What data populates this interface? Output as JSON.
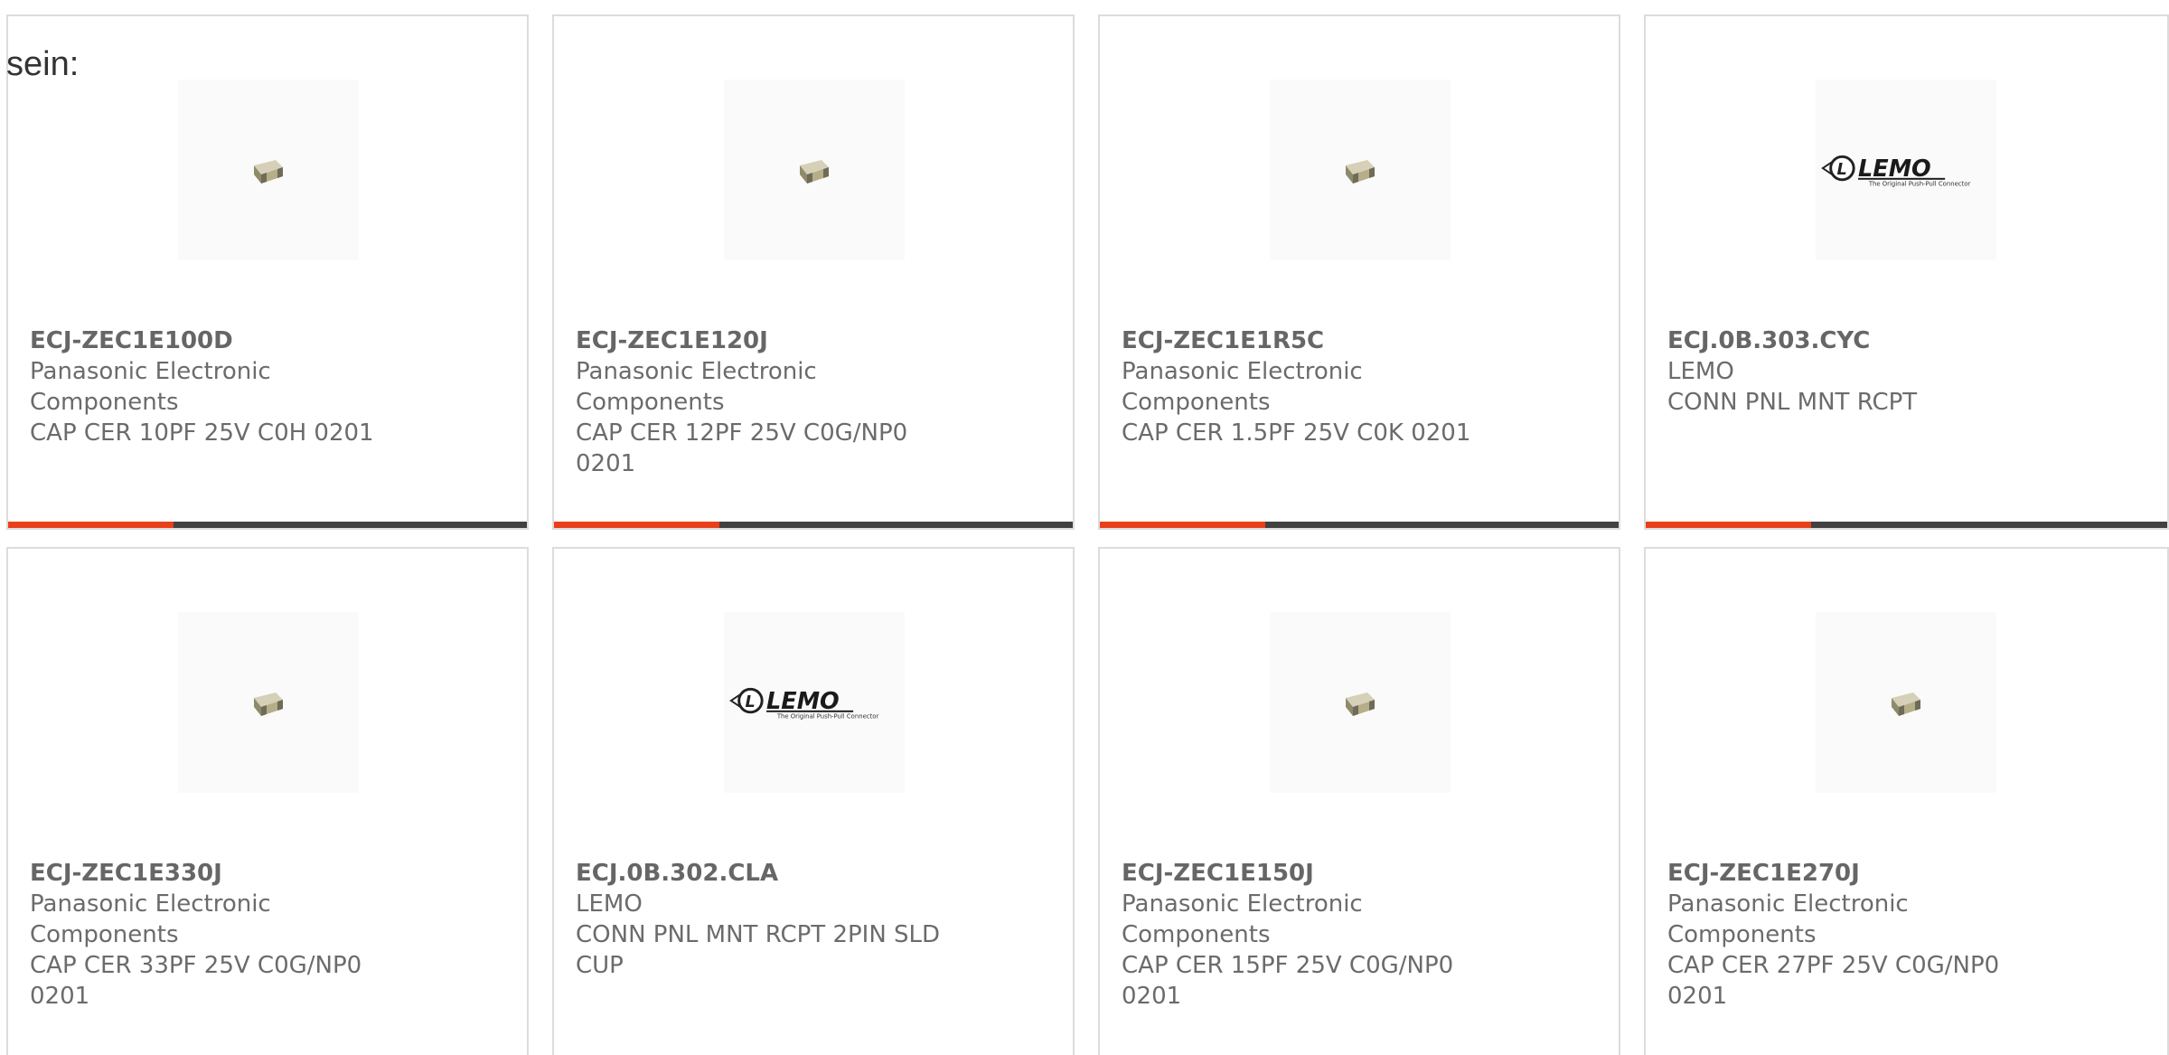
{
  "intro": "sein:",
  "cards": [
    {
      "part_number": "ECJ-ZEC1E100D",
      "manufacturer": "Panasonic Electronic Components",
      "description": "CAP CER 10PF 25V C0H 0201",
      "image": "capacitor-chip-icon"
    },
    {
      "part_number": "ECJ-ZEC1E120J",
      "manufacturer": "Panasonic Electronic Components",
      "description": "CAP CER 12PF 25V C0G/NP0 0201",
      "image": "capacitor-chip-icon"
    },
    {
      "part_number": "ECJ-ZEC1E1R5C",
      "manufacturer": "Panasonic Electronic Components",
      "description": "CAP CER 1.5PF 25V C0K 0201",
      "image": "capacitor-chip-icon"
    },
    {
      "part_number": "ECJ.0B.303.CYC",
      "manufacturer": "LEMO",
      "description": "CONN PNL MNT RCPT",
      "image": "lemo-logo"
    },
    {
      "part_number": "ECJ-ZEC1E330J",
      "manufacturer": "Panasonic Electronic Components",
      "description": "CAP CER 33PF 25V C0G/NP0 0201",
      "image": "capacitor-chip-icon"
    },
    {
      "part_number": "ECJ.0B.302.CLA",
      "manufacturer": "LEMO",
      "description": "CONN PNL MNT RCPT 2PIN SLD CUP",
      "image": "lemo-logo"
    },
    {
      "part_number": "ECJ-ZEC1E150J",
      "manufacturer": "Panasonic Electronic Components",
      "description": "CAP CER 15PF 25V C0G/NP0 0201",
      "image": "capacitor-chip-icon"
    },
    {
      "part_number": "ECJ-ZEC1E270J",
      "manufacturer": "Panasonic Electronic Components",
      "description": "CAP CER 27PF 25V C0G/NP0 0201",
      "image": "capacitor-chip-icon"
    }
  ],
  "logo": {
    "brand": "LEMO",
    "tagline": "The Original Push-Pull Connector"
  },
  "colors": {
    "accent": "#e8401a",
    "bar": "#414141",
    "border": "#dcdcdc",
    "text": "#6b6b6b"
  }
}
